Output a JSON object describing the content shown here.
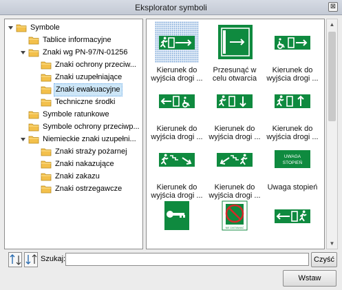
{
  "window": {
    "title": "Eksplorator symboli",
    "close_glyph": "⊠"
  },
  "tree": {
    "root": "Symbole",
    "items": [
      "Tablice informacyjne",
      "Znaki wg PN-97/N-01256",
      "Znaki ochrony przeciw...",
      "Znaki uzupełniające",
      "Znaki ewakuacyjne",
      "Techniczne środki",
      "Symbole ratunkowe",
      "Symbole ochrony przeciwp...",
      "Niemieckie znaki uzupełni...",
      "Znaki straży pożarnej",
      "Znaki nakazujące",
      "Znaki zakazu",
      "Znaki ostrzegawcze"
    ],
    "selected_index": 4
  },
  "symbols": [
    {
      "caption": "Kierunek do wyjścia drogi ...",
      "icon": "exit-running-man-arrow-right-sign"
    },
    {
      "caption": "Przesunąć w celu otwarcia",
      "icon": "slide-to-open-door-sign"
    },
    {
      "caption": "Kierunek do wyjścia drogi ...",
      "icon": "wheelchair-arrow-right-sign"
    },
    {
      "caption": "Kierunek do wyjścia drogi ...",
      "icon": "arrow-left-wheelchair-sign"
    },
    {
      "caption": "Kierunek do wyjścia drogi ...",
      "icon": "running-man-door-arrow-down-sign"
    },
    {
      "caption": "Kierunek do wyjścia drogi ...",
      "icon": "running-man-door-arrow-up-sign"
    },
    {
      "caption": "Kierunek do wyjścia drogi ...",
      "icon": "running-man-stairs-down-right-sign"
    },
    {
      "caption": "Kierunek do wyjścia drogi ...",
      "icon": "running-man-stairs-down-left-sign"
    },
    {
      "caption": "Uwaga stopień",
      "icon": "uwaga-stopien-sign",
      "sign_text_1": "UWAGA",
      "sign_text_2": "STOPIEŃ"
    },
    {
      "caption": "",
      "icon": "key-box-sign"
    },
    {
      "caption": "",
      "icon": "do-not-block-door-sign",
      "sign_text_1": "NIE ZASTAWIAĆ"
    },
    {
      "caption": "",
      "icon": "arrow-left-running-man-sign"
    }
  ],
  "search": {
    "label": "Szukaj:",
    "value": "",
    "clear_label": "Czyść"
  },
  "footer": {
    "insert_label": "Wstaw"
  },
  "colors": {
    "sign_green": "#0f8a3f",
    "selection": "#cde6f7"
  }
}
